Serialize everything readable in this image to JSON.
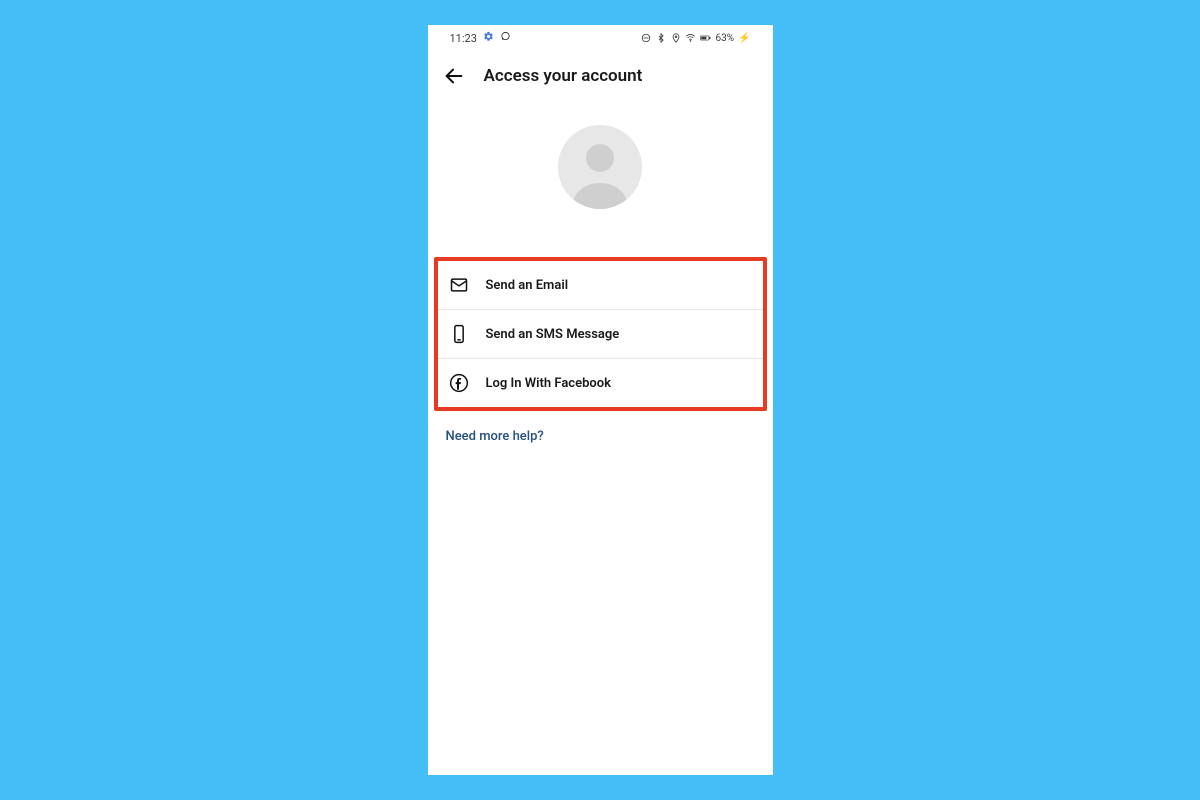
{
  "status_bar": {
    "time": "11:23",
    "battery": "63%"
  },
  "header": {
    "title": "Access your account"
  },
  "options": [
    {
      "label": "Send an Email"
    },
    {
      "label": "Send an SMS Message"
    },
    {
      "label": "Log In With Facebook"
    }
  ],
  "help_link": "Need more help?"
}
